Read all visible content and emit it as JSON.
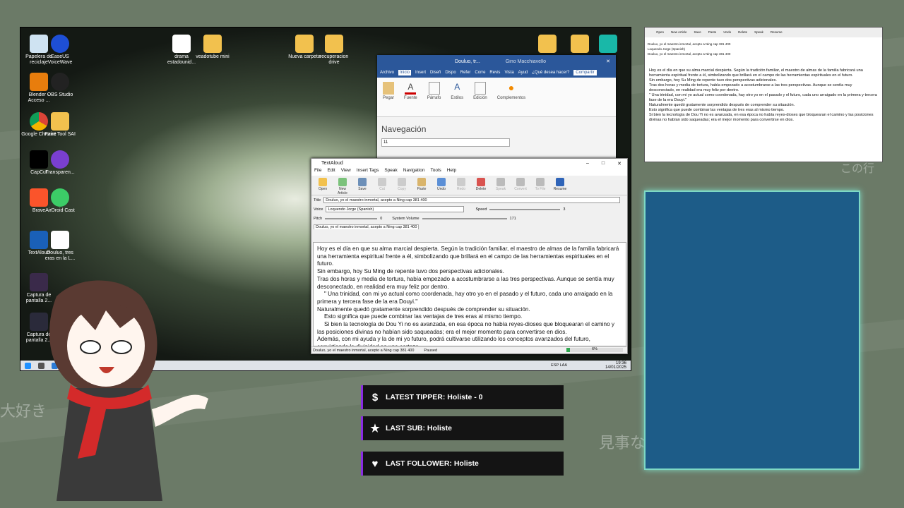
{
  "background": {
    "jp_left": "大好き",
    "jp_mid": "見事な",
    "jp_top": "この行"
  },
  "desktop": {
    "icons": [
      {
        "label": "Papelera de reciclaje"
      },
      {
        "label": "EaseUS VoiceWave"
      },
      {
        "label": "Blender - Acceso ..."
      },
      {
        "label": "OBS Studio"
      },
      {
        "label": "Google Chrome"
      },
      {
        "label": "Paint Tool SAI"
      },
      {
        "label": "CapCut"
      },
      {
        "label": "Transparen..."
      },
      {
        "label": "Brave"
      },
      {
        "label": "AirDroid Cast"
      },
      {
        "label": "TextAloud"
      },
      {
        "label": "Douluo, tres eras en la L..."
      },
      {
        "label": "Captura de pantalla 2..."
      },
      {
        "label": "Captura de pantalla 2..."
      },
      {
        "label": "drama estadounid..."
      },
      {
        "label": "veadotube mini"
      },
      {
        "label": "Nueva carpeta"
      },
      {
        "label": "recuperacion drive"
      }
    ],
    "taskbar": {
      "lang": "ESP LAA",
      "time": "19:36",
      "date": "14/01/2025"
    }
  },
  "word": {
    "title": "Douluo, tr...",
    "user": "Gino Macchiavello",
    "tabs": [
      "Archivo",
      "Inicio",
      "Insert",
      "Diseñ",
      "Dispo",
      "Refer",
      "Corre",
      "Revis",
      "Vista",
      "Ayud",
      "¿Qué desea hacer?",
      "Compartir"
    ],
    "ribbon": [
      "Pegar",
      "Fuente",
      "Párrafo",
      "Estilos",
      "Edición",
      "Complementos"
    ],
    "ribbon_groups": [
      "Portapapeles",
      "Estilos",
      "Complementos"
    ],
    "nav_title": "Navegación",
    "nav_search": "11"
  },
  "textaloud": {
    "title": "TextAloud",
    "menu": [
      "File",
      "Edit",
      "View",
      "Insert Tags",
      "Speak",
      "Navigation",
      "Tools",
      "Help"
    ],
    "toolbar": [
      {
        "label": "Open",
        "enabled": true
      },
      {
        "label": "New Article",
        "enabled": true
      },
      {
        "label": "Save",
        "enabled": true
      },
      {
        "label": "Cut",
        "enabled": false
      },
      {
        "label": "Copy",
        "enabled": false
      },
      {
        "label": "Paste",
        "enabled": true
      },
      {
        "label": "Undo",
        "enabled": true
      },
      {
        "label": "Redo",
        "enabled": false
      },
      {
        "label": "Delete",
        "enabled": true
      },
      {
        "label": "Speak",
        "enabled": false
      },
      {
        "label": "Convert",
        "enabled": false
      },
      {
        "label": "To File",
        "enabled": false
      },
      {
        "label": "Resume",
        "enabled": true
      }
    ],
    "title_label": "Title",
    "title_value": "Douluo, yo el maestro inmortal, acepto a Ning cap 381 400",
    "voice_label": "Voice",
    "voice_value": "Loquendo Jorge (Spanish)",
    "speed_label": "Speed",
    "speed_value": "3",
    "pitch_label": "Pitch",
    "pitch_value": "0",
    "volume_label": "System Volume",
    "volume_value": "171",
    "doc_tab": "Douluo, yo el maestro inmortal, acepto a Ning cap 381 400",
    "body": [
      "Hoy es el día en que su alma marcial despierta. Según la tradición familiar, el maestro de almas de la familia fabricará una herramienta espiritual frente a él, simbolizando que brillará en el campo de las herramientas espirituales en el futuro.",
      "Sin embargo, hoy Su Ming de repente tuvo dos perspectivas adicionales.",
      "Tras dos horas y media de tortura, había empezado a acostumbrarse a las tres perspectivas. Aunque se sentía muy desconectado, en realidad era muy feliz por dentro.",
      "\" Una trinidad, con mi yo actual como coordenada, hay otro yo en el pasado y el futuro, cada uno arraigado en la primera y tercera fase de la era Douyi.\"",
      "Naturalmente quedó gratamente sorprendido después de comprender su situación.",
      "Esto significa que puede combinar las ventajas de tres eras al mismo tiempo.",
      "Si bien la tecnología de Dou Yi no es avanzada, en esa época no había reyes-dioses que bloquearan el camino y las posiciones divinas no habían sido saqueadas; era el mejor momento para convertirse en dios.",
      "Además, con mi ayuda y la de mi yo futuro, podrá cultivarse utilizando los conceptos avanzados del futuro, convirtiendo la divinidad en una certeza."
    ],
    "status_doc": "Douluo, yo el maestro inmortal, acepto a Ning cap 381 400",
    "status_state": "Paused",
    "progress_pct": 6,
    "progress_label": "6%"
  },
  "panels": [
    {
      "icon": "$",
      "text": "LATEST TIPPER: Holiste - 0"
    },
    {
      "icon": "★",
      "text": "LAST SUB: Holiste"
    },
    {
      "icon": "♥",
      "text": "LAST FOLLOWER: Holiste"
    }
  ],
  "colors": {
    "cam_bg": "#1d5c88",
    "cam_border": "#7ed9c4",
    "panel_accent": "#8a2be2",
    "word_blue": "#2b579a"
  }
}
